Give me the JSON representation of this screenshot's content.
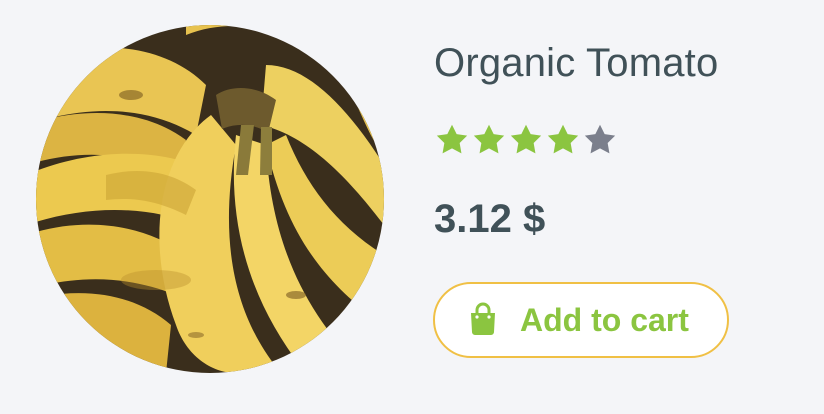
{
  "product": {
    "name": "Organic Tomato",
    "image_subject": "bananas",
    "rating": 4,
    "rating_max": 5,
    "price": "3.12 $",
    "add_to_cart_label": "Add to cart",
    "cart_icon": "shopping-bag-icon",
    "star_icon": "star-icon"
  },
  "colors": {
    "background": "#f4f5f8",
    "text": "#405158",
    "accent_green": "#8bc540",
    "star_empty": "#7b7f8c",
    "button_border": "#f0c045"
  }
}
